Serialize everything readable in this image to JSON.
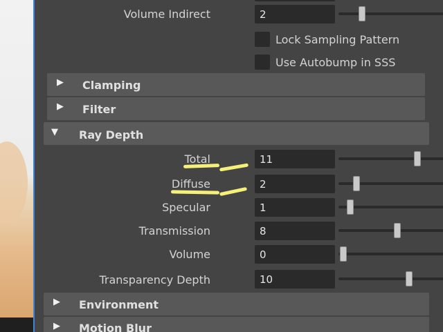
{
  "top_row": {
    "label": "Volume Indirect",
    "value": "2",
    "slider_fraction": 0.2
  },
  "checkboxes": [
    {
      "label": "Lock Sampling Pattern",
      "checked": false
    },
    {
      "label": "Use Autobump in SSS",
      "checked": false
    }
  ],
  "sections": {
    "clamping": "Clamping",
    "filter": "Filter",
    "ray_depth": "Ray Depth",
    "environment": "Environment",
    "motion_blur": "Motion Blur"
  },
  "ray_depth": {
    "total": {
      "label": "Total",
      "value": "11",
      "slider_fraction": 0.67
    },
    "diffuse": {
      "label": "Diffuse",
      "value": "2",
      "slider_fraction": 0.15
    },
    "specular": {
      "label": "Specular",
      "value": "1",
      "slider_fraction": 0.1
    },
    "transmission": {
      "label": "Transmission",
      "value": "8",
      "slider_fraction": 0.5
    },
    "volume": {
      "label": "Volume",
      "value": "0",
      "slider_fraction": 0.04
    },
    "transparency": {
      "label": "Transparency Depth",
      "value": "10",
      "slider_fraction": 0.6
    }
  },
  "colors": {
    "panel_bg": "#444444",
    "section_bg": "#585858",
    "field_bg": "#2a2a2a",
    "highlight": "#f5f07a",
    "viewport_edge": "#3d86d6"
  },
  "icons": {
    "collapsed": "triangle-right-icon",
    "expanded": "triangle-down-icon"
  }
}
